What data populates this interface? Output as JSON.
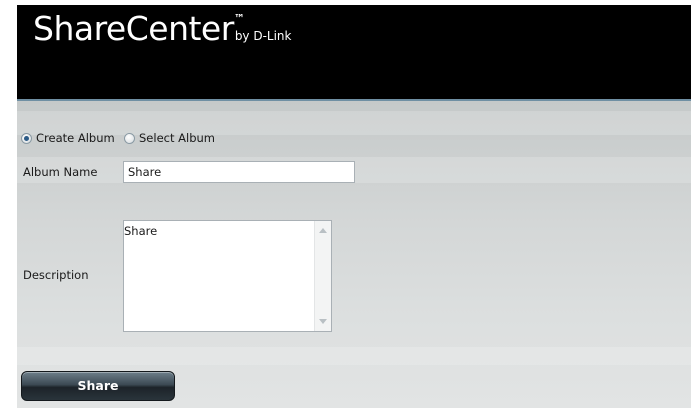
{
  "header": {
    "logo_main": "ShareCenter",
    "logo_tm": "™",
    "logo_by": "by D-Link"
  },
  "album_mode": {
    "options": [
      {
        "label": "Create Album",
        "selected": true
      },
      {
        "label": "Select Album",
        "selected": false
      }
    ]
  },
  "form": {
    "album_name_label": "Album Name",
    "album_name_value": "Share",
    "description_label": "Description",
    "description_value": "Share"
  },
  "actions": {
    "submit_label": "Share"
  },
  "colors": {
    "header_background": "#000000",
    "content_background": "#d4d7d7",
    "button_background": "#2a343b"
  }
}
